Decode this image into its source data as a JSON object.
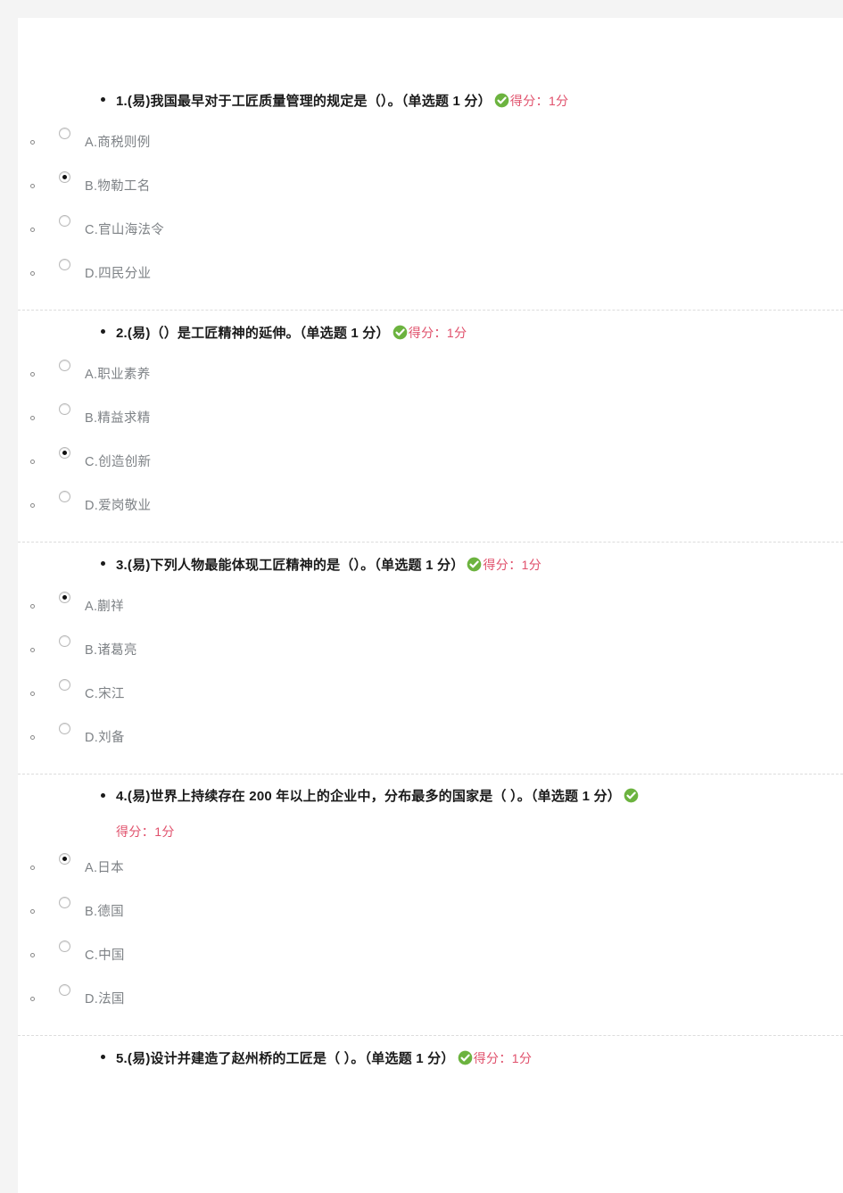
{
  "colors": {
    "page_background": "#ffffff",
    "outer_background": "#f4f4f4",
    "question_text": "#1a1a1a",
    "option_text": "#7e8286",
    "score_text": "#e0506b",
    "check_icon": "#6cb33f",
    "separator": "#dcdcdc"
  },
  "icons": {
    "correct": "check-circle-icon",
    "question_bullet": "disc-bullet-icon",
    "option_bullet": "circle-bullet-icon"
  },
  "quiz": {
    "questions": [
      {
        "number": "1.",
        "difficulty": "(易)",
        "text": "我国最早对于工匠质量管理的规定是（）。（单选题 1 分）",
        "score": "得分：1分",
        "score_wraps": false,
        "options": [
          {
            "label": "A.商税则例",
            "checked": false
          },
          {
            "label": "B.物勒工名",
            "checked": true
          },
          {
            "label": "C.官山海法令",
            "checked": false
          },
          {
            "label": "D.四民分业",
            "checked": false
          }
        ]
      },
      {
        "number": "2.",
        "difficulty": "(易)",
        "text": "（）是工匠精神的延伸。（单选题 1 分）",
        "score": "得分：1分",
        "score_wraps": false,
        "options": [
          {
            "label": "A.职业素养",
            "checked": false
          },
          {
            "label": "B.精益求精",
            "checked": false
          },
          {
            "label": "C.创造创新",
            "checked": true
          },
          {
            "label": "D.爱岗敬业",
            "checked": false
          }
        ]
      },
      {
        "number": "3.",
        "difficulty": "(易)",
        "text": "下列人物最能体现工匠精神的是（）。（单选题 1 分）",
        "score": "得分：1分",
        "score_wraps": false,
        "options": [
          {
            "label": "A.蒯祥",
            "checked": true
          },
          {
            "label": "B.诸葛亮",
            "checked": false
          },
          {
            "label": "C.宋江",
            "checked": false
          },
          {
            "label": "D.刘备",
            "checked": false
          }
        ]
      },
      {
        "number": "4.",
        "difficulty": "(易)",
        "text": "世界上持续存在 200 年以上的企业中，分布最多的国家是（  ）。（单选题 1 分）",
        "score": "得分：1分",
        "score_wraps": true,
        "options": [
          {
            "label": "A.日本",
            "checked": true
          },
          {
            "label": "B.德国",
            "checked": false
          },
          {
            "label": "C.中国",
            "checked": false
          },
          {
            "label": "D.法国",
            "checked": false
          }
        ]
      },
      {
        "number": "5.",
        "difficulty": "(易)",
        "text": "设计并建造了赵州桥的工匠是（  ）。（单选题 1 分）",
        "score": "得分：1分",
        "score_wraps": false,
        "options": []
      }
    ]
  }
}
